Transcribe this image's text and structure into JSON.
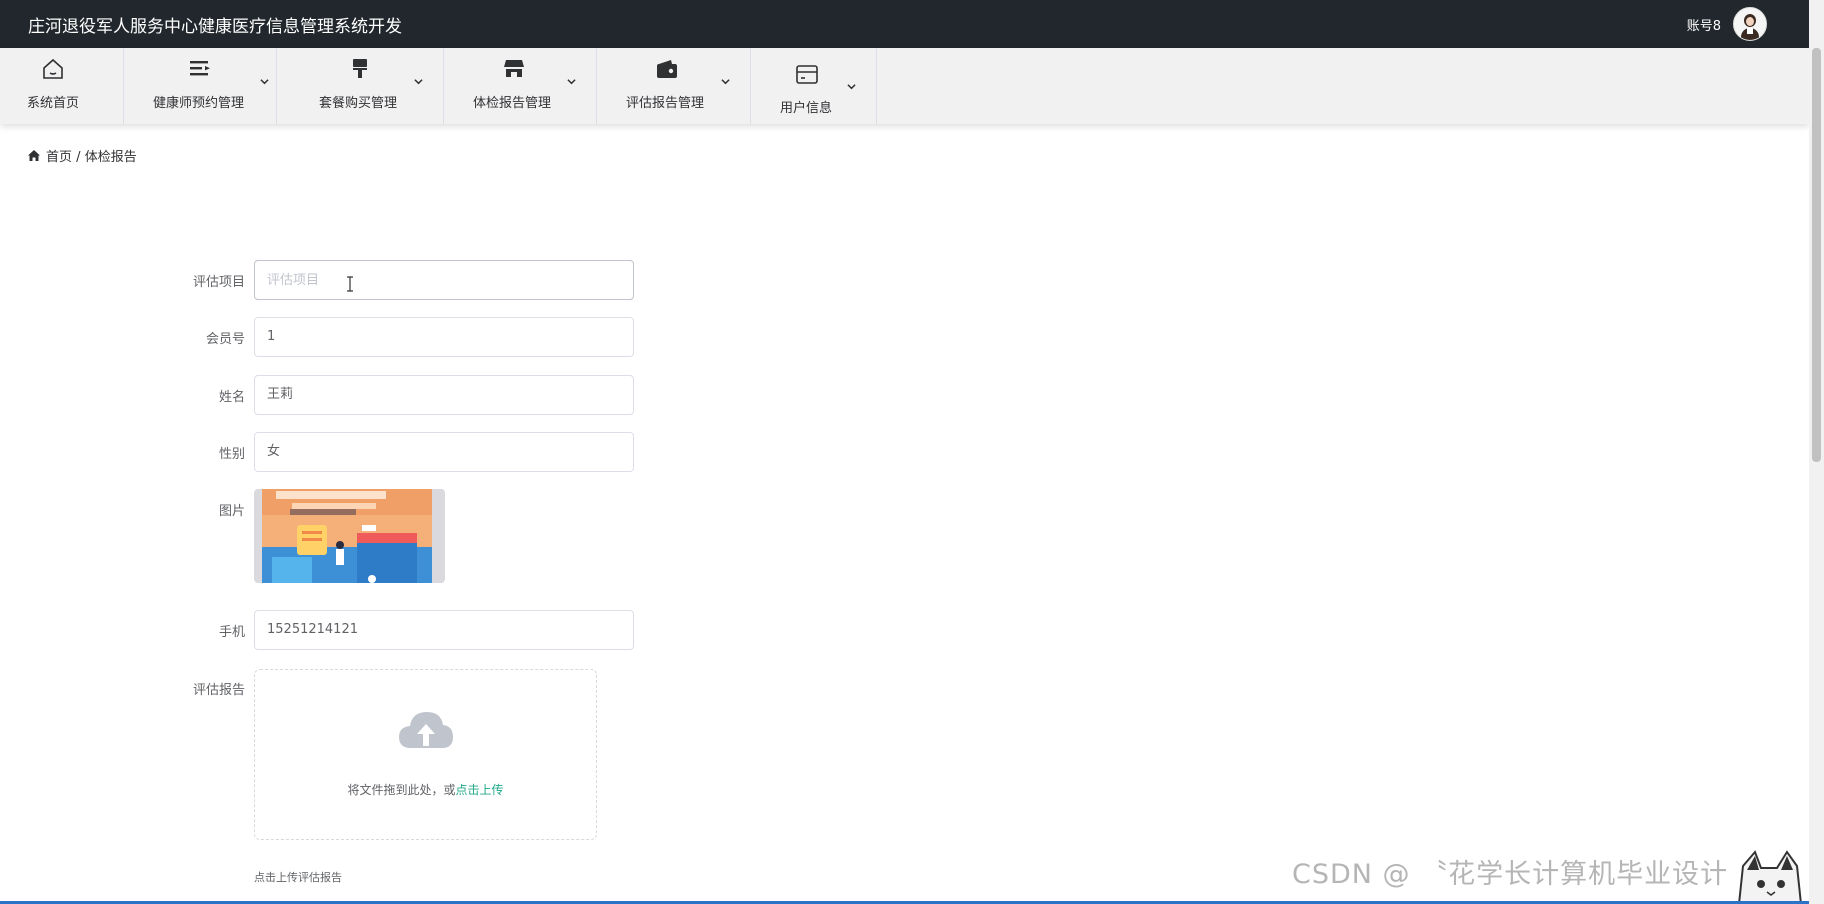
{
  "header": {
    "app_title": "庄河退役军人服务中心健康医疗信息管理系统开发",
    "account": "账号8",
    "avatar_icon": "user-avatar"
  },
  "nav": {
    "items": [
      {
        "label": "系统首页",
        "icon": "home-icon"
      },
      {
        "label": "健康师预约管理",
        "icon": "list-icon"
      },
      {
        "label": "套餐购买管理",
        "icon": "brush-icon"
      },
      {
        "label": "体检报告管理",
        "icon": "shop-icon"
      },
      {
        "label": "评估报告管理",
        "icon": "wallet-icon"
      },
      {
        "label": "用户信息",
        "icon": "card-icon"
      }
    ]
  },
  "breadcrumb": {
    "home": "首页",
    "separator": "/",
    "current": "体检报告"
  },
  "form": {
    "project": {
      "label": "评估项目",
      "placeholder": "评估项目",
      "value": ""
    },
    "member_no": {
      "label": "会员号",
      "value": "1"
    },
    "name": {
      "label": "姓名",
      "value": "王莉"
    },
    "gender": {
      "label": "性别",
      "value": "女"
    },
    "picture": {
      "label": "图片"
    },
    "phone": {
      "label": "手机",
      "value": "15251214121"
    },
    "report": {
      "label": "评估报告",
      "drop_text": "将文件拖到此处，或",
      "click_text": "点击上传",
      "tip": "点击上传评估报告"
    }
  },
  "watermark": {
    "text": "CSDN @ 〝花学长计算机毕业设计"
  },
  "colors": {
    "topbar": "#22272d",
    "nav": "#f1f1f2",
    "accent": "#21a88a",
    "border": "#dcdfe6"
  }
}
